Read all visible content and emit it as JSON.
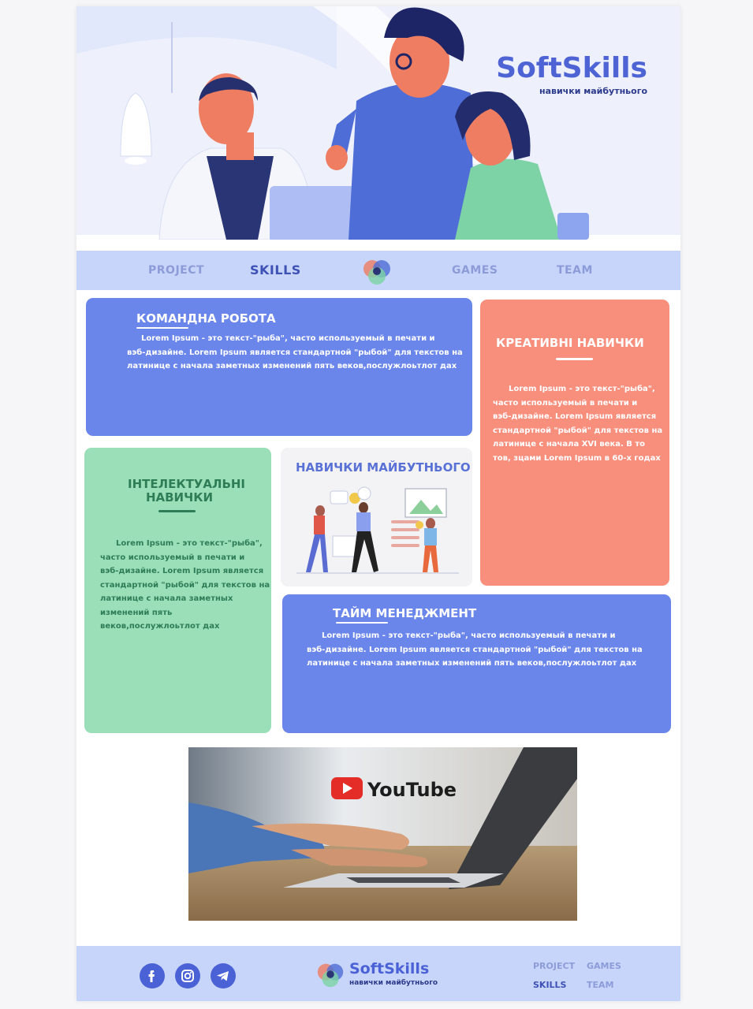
{
  "brand": {
    "title": "SoftSkills",
    "subtitle": "навички майбутнього"
  },
  "nav": {
    "items": [
      "PROJECT",
      "SKILLS",
      "GAMES",
      "TEAM"
    ],
    "active": "SKILLS"
  },
  "cards": {
    "teamwork": {
      "title": "КОМАНДНА РОБОТА",
      "lines": [
        "Lorem Ipsum - это текст-\"рыба\", часто используемый в печати и",
        "вэб-дизайне. Lorem Ipsum является стандартной \"рыбой\" для текстов на",
        "латинице с начала заметных изменений пять веков,послужлоьтлот дах"
      ]
    },
    "creative": {
      "title": "КРЕАТИВНІ НАВИЧКИ",
      "lines": [
        "Lorem Ipsum - это текст-\"рыба\",",
        "часто используемый в печати и",
        "вэб-дизайне. Lorem Ipsum является",
        "стандартной \"рыбой\" для текстов на",
        "латинице с начала XVI века. В то",
        "тов, зцами Lorem Ipsum в 60-х годах"
      ]
    },
    "intellectual": {
      "title_line1": "ІНТЕЛЕКТУАЛЬНІ",
      "title_line2": "НАВИЧКИ",
      "lines": [
        "Lorem Ipsum - это текст-\"рыба\",",
        "часто используемый в печати и",
        "вэб-дизайне. Lorem Ipsum является",
        "стандартной \"рыбой\" для текстов на",
        "латинице с начала заметных",
        "изменений пять",
        "веков,послужлоьтлот дах"
      ]
    },
    "future": {
      "title": "НАВИЧКИ МАЙБУТНЬОГО"
    },
    "time": {
      "title": "ТАЙМ МЕНЕДЖМЕНТ",
      "lines": [
        "Lorem Ipsum - это текст-\"рыба\", часто используемый в печати и",
        "вэб-дизайне. Lorem Ipsum является стандартной \"рыбой\" для текстов на",
        "латинице с начала заметных изменений пять веков,послужлоьтлот дах"
      ]
    }
  },
  "video": {
    "label": "YouTube"
  },
  "footer": {
    "social": [
      "facebook-icon",
      "instagram-icon",
      "telegram-icon"
    ],
    "brand_title": "SoftSkills",
    "brand_subtitle": "навички майбутнього",
    "links": [
      "PROJECT",
      "GAMES",
      "SKILLS",
      "TEAM"
    ]
  },
  "colors": {
    "blue_card": "#6a86ea",
    "salmon_card": "#f88f7d",
    "green_card": "#9adfb8",
    "nav_bg": "#c7d5fb",
    "brand": "#4e63d4"
  }
}
